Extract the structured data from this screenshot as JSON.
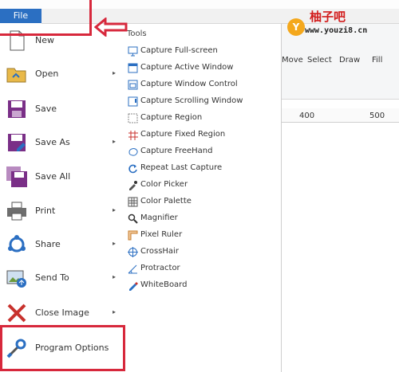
{
  "menu": {
    "file_label": "File"
  },
  "left_items": [
    {
      "label": "New",
      "icon": "new-file-icon",
      "arrow": ""
    },
    {
      "label": "Open",
      "icon": "open-folder-icon",
      "arrow": "▸"
    },
    {
      "label": "Save",
      "icon": "save-icon",
      "arrow": ""
    },
    {
      "label": "Save As",
      "icon": "save-as-icon",
      "arrow": "▸"
    },
    {
      "label": "Save All",
      "icon": "save-all-icon",
      "arrow": ""
    },
    {
      "label": "Print",
      "icon": "print-icon",
      "arrow": "▸"
    },
    {
      "label": "Share",
      "icon": "share-icon",
      "arrow": "▸"
    },
    {
      "label": "Send To",
      "icon": "send-to-icon",
      "arrow": "▸"
    },
    {
      "label": "Close Image",
      "icon": "close-image-icon",
      "arrow": "▸"
    },
    {
      "label": "Program Options",
      "icon": "wrench-icon",
      "arrow": ""
    }
  ],
  "tools": {
    "heading": "Tools",
    "items": [
      {
        "label": "Capture Full-screen",
        "icon": "monitor-icon"
      },
      {
        "label": "Capture Active Window",
        "icon": "window-icon"
      },
      {
        "label": "Capture Window Control",
        "icon": "window-control-icon"
      },
      {
        "label": "Capture Scrolling Window",
        "icon": "scroll-window-icon"
      },
      {
        "label": "Capture Region",
        "icon": "region-icon"
      },
      {
        "label": "Capture Fixed Region",
        "icon": "fixed-region-icon"
      },
      {
        "label": "Capture FreeHand",
        "icon": "freehand-icon"
      },
      {
        "label": "Repeat Last Capture",
        "icon": "repeat-icon"
      },
      {
        "label": "Color Picker",
        "icon": "eyedropper-icon"
      },
      {
        "label": "Color Palette",
        "icon": "palette-icon"
      },
      {
        "label": "Magnifier",
        "icon": "magnifier-icon"
      },
      {
        "label": "Pixel Ruler",
        "icon": "ruler-icon"
      },
      {
        "label": "CrossHair",
        "icon": "crosshair-icon"
      },
      {
        "label": "Protractor",
        "icon": "protractor-icon"
      },
      {
        "label": "WhiteBoard",
        "icon": "whiteboard-icon"
      }
    ]
  },
  "ribbon": {
    "move": "Move",
    "select": "Select",
    "draw": "Draw",
    "fill": "Fill"
  },
  "ruler": {
    "mark1": "400",
    "mark2": "500"
  },
  "watermark": {
    "title": "柚子吧",
    "url": "www.youzi8.cn",
    "badge": "Y"
  },
  "colors": {
    "file_tab": "#2b6fc2",
    "highlight": "#d7283c",
    "icon_purple": "#7a2f87",
    "icon_blue": "#2b6fc2"
  }
}
